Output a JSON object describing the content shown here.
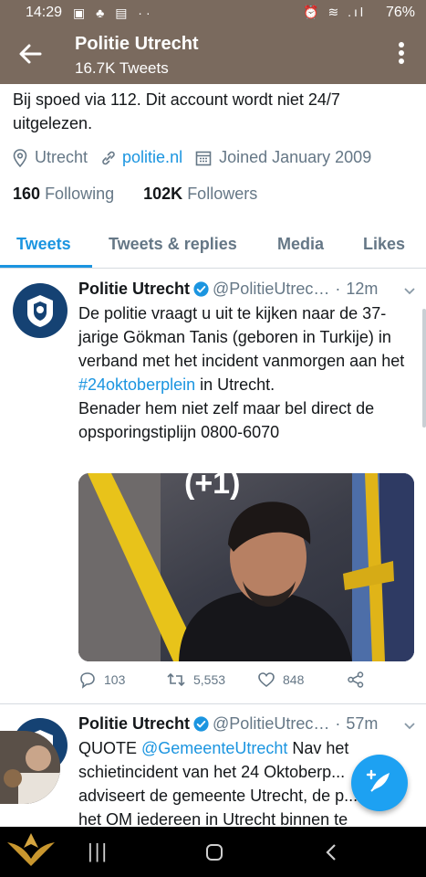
{
  "status_bar": {
    "time": "14:29",
    "battery": "76%"
  },
  "header": {
    "title": "Politie Utrecht",
    "subtitle": "16.7K Tweets"
  },
  "profile": {
    "bio": "Bij spoed via 112. Dit account wordt niet 24/7 uitgelezen.",
    "location": "Utrecht",
    "website": "politie.nl",
    "joined": "Joined January 2009",
    "following_count": "160",
    "following_label": "Following",
    "followers_count": "102K",
    "followers_label": "Followers"
  },
  "tabs": [
    {
      "label": "Tweets",
      "active": true
    },
    {
      "label": "Tweets & replies",
      "active": false
    },
    {
      "label": "Media",
      "active": false
    },
    {
      "label": "Likes",
      "active": false
    }
  ],
  "tweets": [
    {
      "name": "Politie Utrecht",
      "handle": "@PolitieUtrec…",
      "time": "12m",
      "text_1": "De politie vraagt u uit te kijken naar de 37-jarige Gökman Tanis (geboren in Turkije) in verband met het incident vanmorgen aan het ",
      "hashtag": "#24oktoberplein",
      "text_2": " in Utrecht.",
      "text_3": "Benader hem niet zelf maar bel direct de opsporingstiplijn 0800-6070",
      "media_caption": "(+1)",
      "replies": "103",
      "retweets": "5,553",
      "likes": "848"
    },
    {
      "name": "Politie Utrecht",
      "handle": "@PolitieUtrec…",
      "time": "57m",
      "text_1": "QUOTE ",
      "mention": "@GemeenteUtrecht",
      "text_2": " Nav het schietincident van het 24 Oktoberp... adviseert de gemeente Utrecht, de p... en het OM iedereen in Utrecht binnen te"
    }
  ],
  "colors": {
    "accent": "#1b95e0",
    "header_bg": "#7a6a5e",
    "police_blue": "#154273",
    "fab": "#1da1f2"
  }
}
